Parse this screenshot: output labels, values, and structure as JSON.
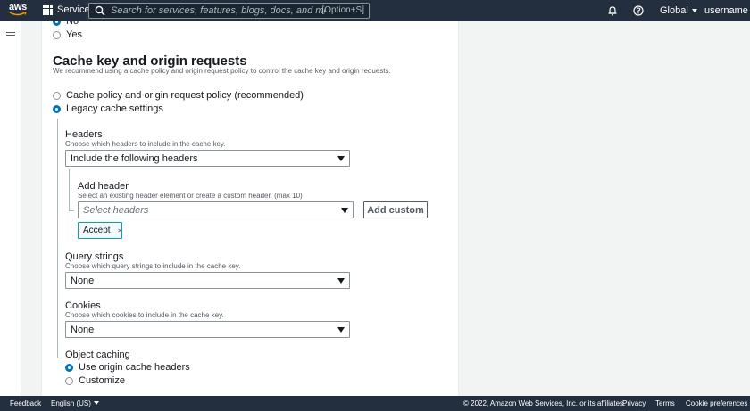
{
  "topnav": {
    "logo_text": "aws",
    "services_label": "Services",
    "search_placeholder": "Search for services, features, blogs, docs, and more",
    "search_shortcut": "[Option+S]",
    "region_label": "Global",
    "user_label": "username"
  },
  "form": {
    "prev_options": [
      {
        "label": "No",
        "selected": true
      },
      {
        "label": "Yes",
        "selected": false
      }
    ],
    "section_title": "Cache key and origin requests",
    "section_desc": "We recommend using a cache policy and origin request policy to control the cache key and origin requests.",
    "cache_options": [
      {
        "label": "Cache policy and origin request policy (recommended)",
        "selected": false
      },
      {
        "label": "Legacy cache settings",
        "selected": true
      }
    ],
    "headers": {
      "label": "Headers",
      "desc": "Choose which headers to include in the cache key.",
      "value": "Include the following headers"
    },
    "add_header": {
      "label": "Add header",
      "desc": "Select an existing header element or create a custom header. (max 10)",
      "placeholder": "Select headers",
      "button": "Add custom",
      "token": "Accept"
    },
    "query_strings": {
      "label": "Query strings",
      "desc": "Choose which query strings to include in the cache key.",
      "value": "None"
    },
    "cookies": {
      "label": "Cookies",
      "desc": "Choose which cookies to include in the cache key.",
      "value": "None"
    },
    "object_caching": {
      "label": "Object caching",
      "options": [
        {
          "label": "Use origin cache headers",
          "selected": true
        },
        {
          "label": "Customize",
          "selected": false
        }
      ]
    }
  },
  "footer": {
    "feedback": "Feedback",
    "language": "English (US)",
    "copyright": "© 2022, Amazon Web Services, Inc. or its affiliates.",
    "privacy": "Privacy",
    "terms": "Terms",
    "cookie_prefs": "Cookie preferences"
  },
  "colors": {
    "nav_bg": "#232f3e",
    "accent": "#0073bb",
    "token_border": "#00a1c9"
  }
}
